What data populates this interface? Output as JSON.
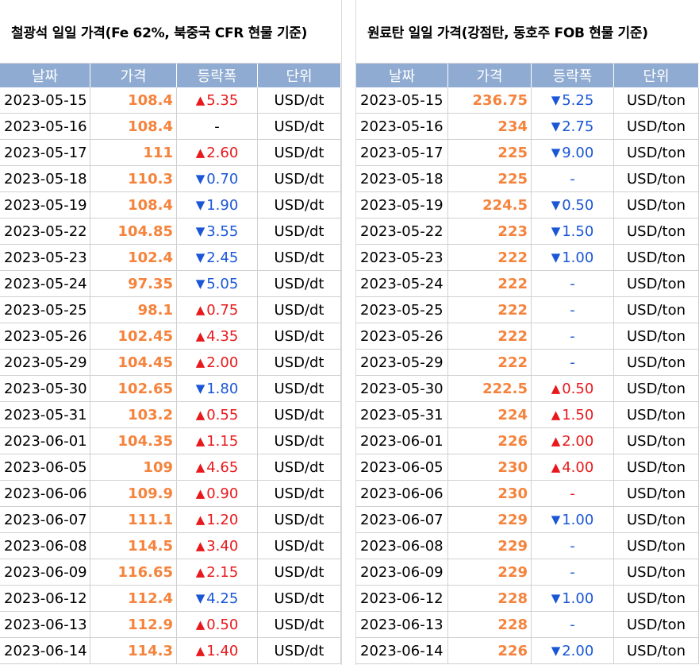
{
  "colors": {
    "header_bg": "#8fabd1",
    "price": "#f5833c",
    "up": "#e8191c",
    "down": "#1a56d6"
  },
  "left": {
    "title": "철광석 일일 가격(Fe 62%, 북중국 CFR 현물 기준)",
    "headers": [
      "날짜",
      "가격",
      "등락폭",
      "단위"
    ],
    "rows": [
      {
        "date": "2023-05-15",
        "price": "108.4",
        "dir": "up",
        "change": "5.35",
        "unit": "USD/dt"
      },
      {
        "date": "2023-05-16",
        "price": "108.4",
        "dir": "flat",
        "change": "-",
        "unit": "USD/dt"
      },
      {
        "date": "2023-05-17",
        "price": "111",
        "dir": "up",
        "change": "2.60",
        "unit": "USD/dt"
      },
      {
        "date": "2023-05-18",
        "price": "110.3",
        "dir": "down",
        "change": "0.70",
        "unit": "USD/dt"
      },
      {
        "date": "2023-05-19",
        "price": "108.4",
        "dir": "down",
        "change": "1.90",
        "unit": "USD/dt"
      },
      {
        "date": "2023-05-22",
        "price": "104.85",
        "dir": "down",
        "change": "3.55",
        "unit": "USD/dt"
      },
      {
        "date": "2023-05-23",
        "price": "102.4",
        "dir": "down",
        "change": "2.45",
        "unit": "USD/dt"
      },
      {
        "date": "2023-05-24",
        "price": "97.35",
        "dir": "down",
        "change": "5.05",
        "unit": "USD/dt"
      },
      {
        "date": "2023-05-25",
        "price": "98.1",
        "dir": "up",
        "change": "0.75",
        "unit": "USD/dt"
      },
      {
        "date": "2023-05-26",
        "price": "102.45",
        "dir": "up",
        "change": "4.35",
        "unit": "USD/dt"
      },
      {
        "date": "2023-05-29",
        "price": "104.45",
        "dir": "up",
        "change": "2.00",
        "unit": "USD/dt"
      },
      {
        "date": "2023-05-30",
        "price": "102.65",
        "dir": "down",
        "change": "1.80",
        "unit": "USD/dt"
      },
      {
        "date": "2023-05-31",
        "price": "103.2",
        "dir": "up",
        "change": "0.55",
        "unit": "USD/dt"
      },
      {
        "date": "2023-06-01",
        "price": "104.35",
        "dir": "up",
        "change": "1.15",
        "unit": "USD/dt"
      },
      {
        "date": "2023-06-05",
        "price": "109",
        "dir": "up",
        "change": "4.65",
        "unit": "USD/dt"
      },
      {
        "date": "2023-06-06",
        "price": "109.9",
        "dir": "up",
        "change": "0.90",
        "unit": "USD/dt"
      },
      {
        "date": "2023-06-07",
        "price": "111.1",
        "dir": "up",
        "change": "1.20",
        "unit": "USD/dt"
      },
      {
        "date": "2023-06-08",
        "price": "114.5",
        "dir": "up",
        "change": "3.40",
        "unit": "USD/dt"
      },
      {
        "date": "2023-06-09",
        "price": "116.65",
        "dir": "up",
        "change": "2.15",
        "unit": "USD/dt"
      },
      {
        "date": "2023-06-12",
        "price": "112.4",
        "dir": "down",
        "change": "4.25",
        "unit": "USD/dt"
      },
      {
        "date": "2023-06-13",
        "price": "112.9",
        "dir": "up",
        "change": "0.50",
        "unit": "USD/dt"
      },
      {
        "date": "2023-06-14",
        "price": "114.3",
        "dir": "up",
        "change": "1.40",
        "unit": "USD/dt"
      }
    ]
  },
  "right": {
    "title": "원료탄 일일 가격(강점탄, 동호주 FOB 현물 기준)",
    "headers": [
      "날짜",
      "가격",
      "등락폭",
      "단위"
    ],
    "rows": [
      {
        "date": "2023-05-15",
        "price": "236.75",
        "dir": "down",
        "change": "5.25",
        "unit": "USD/ton"
      },
      {
        "date": "2023-05-16",
        "price": "234",
        "dir": "down",
        "change": "2.75",
        "unit": "USD/ton"
      },
      {
        "date": "2023-05-17",
        "price": "225",
        "dir": "down",
        "change": "9.00",
        "unit": "USD/ton"
      },
      {
        "date": "2023-05-18",
        "price": "225",
        "dir": "flat-blue",
        "change": "-",
        "unit": "USD/ton"
      },
      {
        "date": "2023-05-19",
        "price": "224.5",
        "dir": "down",
        "change": "0.50",
        "unit": "USD/ton"
      },
      {
        "date": "2023-05-22",
        "price": "223",
        "dir": "down",
        "change": "1.50",
        "unit": "USD/ton"
      },
      {
        "date": "2023-05-23",
        "price": "222",
        "dir": "down",
        "change": "1.00",
        "unit": "USD/ton"
      },
      {
        "date": "2023-05-24",
        "price": "222",
        "dir": "flat-blue",
        "change": "-",
        "unit": "USD/ton"
      },
      {
        "date": "2023-05-25",
        "price": "222",
        "dir": "flat-blue",
        "change": "-",
        "unit": "USD/ton"
      },
      {
        "date": "2023-05-26",
        "price": "222",
        "dir": "flat-blue",
        "change": "-",
        "unit": "USD/ton"
      },
      {
        "date": "2023-05-29",
        "price": "222",
        "dir": "flat-blue",
        "change": "-",
        "unit": "USD/ton"
      },
      {
        "date": "2023-05-30",
        "price": "222.5",
        "dir": "up",
        "change": "0.50",
        "unit": "USD/ton"
      },
      {
        "date": "2023-05-31",
        "price": "224",
        "dir": "up",
        "change": "1.50",
        "unit": "USD/ton"
      },
      {
        "date": "2023-06-01",
        "price": "226",
        "dir": "up",
        "change": "2.00",
        "unit": "USD/ton"
      },
      {
        "date": "2023-06-05",
        "price": "230",
        "dir": "up",
        "change": "4.00",
        "unit": "USD/ton"
      },
      {
        "date": "2023-06-06",
        "price": "230",
        "dir": "flat-red",
        "change": "-",
        "unit": "USD/ton"
      },
      {
        "date": "2023-06-07",
        "price": "229",
        "dir": "down",
        "change": "1.00",
        "unit": "USD/ton"
      },
      {
        "date": "2023-06-08",
        "price": "229",
        "dir": "flat-blue",
        "change": "-",
        "unit": "USD/ton"
      },
      {
        "date": "2023-06-09",
        "price": "229",
        "dir": "flat-blue",
        "change": "-",
        "unit": "USD/ton"
      },
      {
        "date": "2023-06-12",
        "price": "228",
        "dir": "down",
        "change": "1.00",
        "unit": "USD/ton"
      },
      {
        "date": "2023-06-13",
        "price": "228",
        "dir": "flat-blue",
        "change": "-",
        "unit": "USD/ton"
      },
      {
        "date": "2023-06-14",
        "price": "226",
        "dir": "down",
        "change": "2.00",
        "unit": "USD/ton"
      }
    ]
  }
}
